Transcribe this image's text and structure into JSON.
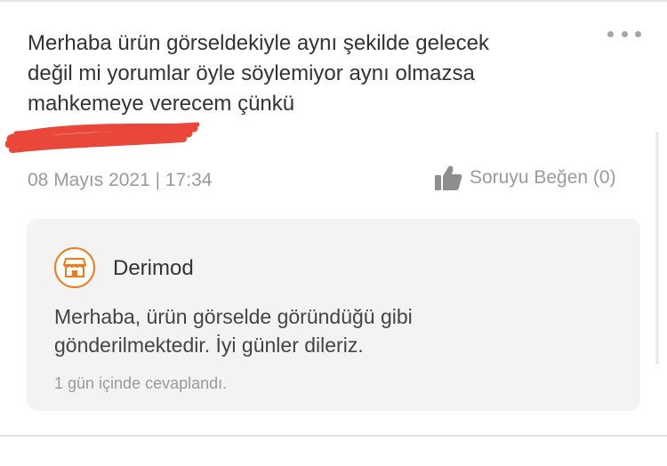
{
  "question": {
    "text_line1": "Merhaba ürün görseldekiyle aynı şekilde gelecek",
    "text_line2": "değil mi yorumlar öyle söylemiyor aynı olmazsa",
    "text_line3": "mahkemeye verecem çünkü",
    "date": "08 Mayıs 2021 | 17:34",
    "like_label": "Soruyu Beğen (0)",
    "more_icon": "ellipsis-icon",
    "like_icon": "thumbs-up-icon"
  },
  "answer": {
    "seller_name": "Derimod",
    "seller_icon": "store-icon",
    "text_line1": "Merhaba, ürün görselde göründüğü gibi",
    "text_line2": "gönderilmektedir. İyi günler dileriz.",
    "answered_in": "1 gün içinde cevaplandı."
  },
  "colors": {
    "accent": "#f27a1a",
    "redaction": "#e8473a",
    "text": "#333333",
    "muted": "#9a9a9a",
    "answer_bg": "#f3f3f3"
  }
}
